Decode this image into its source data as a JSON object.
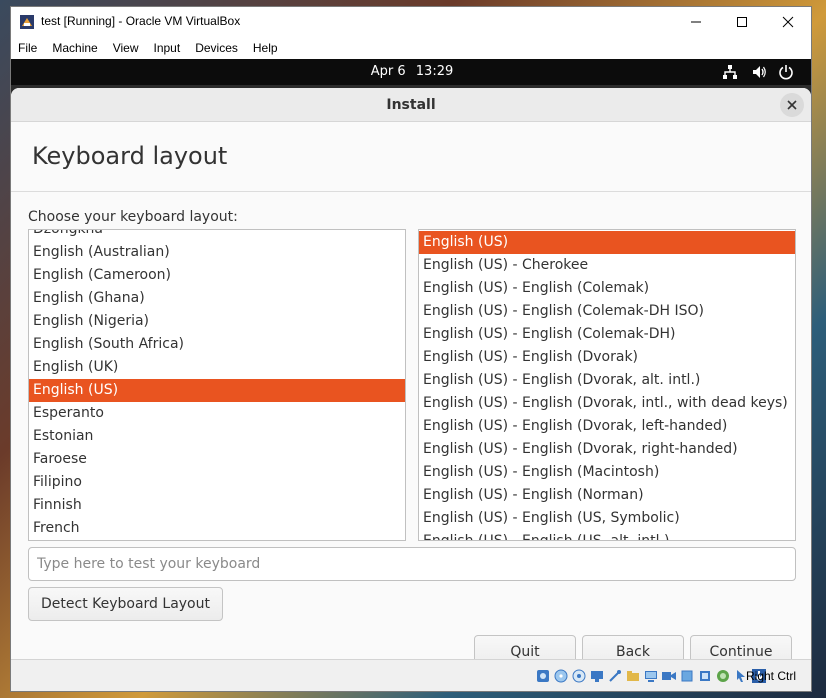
{
  "host_window": {
    "title": "test [Running] - Oracle VM VirtualBox",
    "menu": [
      "File",
      "Machine",
      "View",
      "Input",
      "Devices",
      "Help"
    ],
    "host_key": "Right Ctrl"
  },
  "guest_topbar": {
    "date": "Apr 6",
    "time": "13:29"
  },
  "installer": {
    "window_title": "Install",
    "heading": "Keyboard layout",
    "choose_label": "Choose your keyboard layout:",
    "layouts": [
      "Dzongkha",
      "English (Australian)",
      "English (Cameroon)",
      "English (Ghana)",
      "English (Nigeria)",
      "English (South Africa)",
      "English (UK)",
      "English (US)",
      "Esperanto",
      "Estonian",
      "Faroese",
      "Filipino",
      "Finnish",
      "French"
    ],
    "selected_layout": "English (US)",
    "variants": [
      "English (US)",
      "English (US) - Cherokee",
      "English (US) - English (Colemak)",
      "English (US) - English (Colemak-DH ISO)",
      "English (US) - English (Colemak-DH)",
      "English (US) - English (Dvorak)",
      "English (US) - English (Dvorak, alt. intl.)",
      "English (US) - English (Dvorak, intl., with dead keys)",
      "English (US) - English (Dvorak, left-handed)",
      "English (US) - English (Dvorak, right-handed)",
      "English (US) - English (Macintosh)",
      "English (US) - English (Norman)",
      "English (US) - English (US, Symbolic)",
      "English (US) - English (US, alt. intl.)"
    ],
    "selected_variant": "English (US)",
    "test_input_placeholder": "Type here to test your keyboard",
    "detect_button": "Detect Keyboard Layout",
    "quit_button": "Quit",
    "back_button": "Back",
    "continue_button": "Continue",
    "accent_color": "#e95420"
  }
}
